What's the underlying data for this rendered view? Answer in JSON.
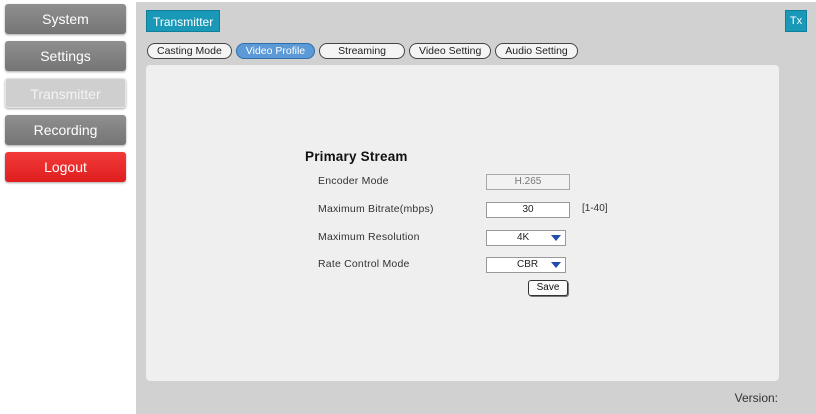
{
  "sidebar": {
    "items": [
      {
        "label": "System"
      },
      {
        "label": "Settings"
      },
      {
        "label": "Transmitter"
      },
      {
        "label": "Recording"
      },
      {
        "label": "Logout"
      }
    ]
  },
  "header": {
    "title": "Transmitter",
    "badge": "Tx"
  },
  "tabs": [
    {
      "label": "Casting Mode"
    },
    {
      "label": "Video Profile"
    },
    {
      "label": "Streaming"
    },
    {
      "label": "Video Setting"
    },
    {
      "label": "Audio Setting"
    }
  ],
  "form": {
    "section_title": "Primary Stream",
    "encoder_mode": {
      "label": "Encoder Mode",
      "value": "H.265"
    },
    "max_bitrate": {
      "label": "Maximum Bitrate(mbps)",
      "value": "30",
      "range": "[1-40]"
    },
    "max_resolution": {
      "label": "Maximum Resolution",
      "value": "4K"
    },
    "rate_control": {
      "label": "Rate Control Mode",
      "value": "CBR"
    },
    "save_label": "Save"
  },
  "footer": {
    "version_label": "Version:"
  },
  "colors": {
    "accent": "#1a98b8",
    "active_tab": "#5b9ad6",
    "logout": "#e8262b",
    "nav": "#808080"
  }
}
